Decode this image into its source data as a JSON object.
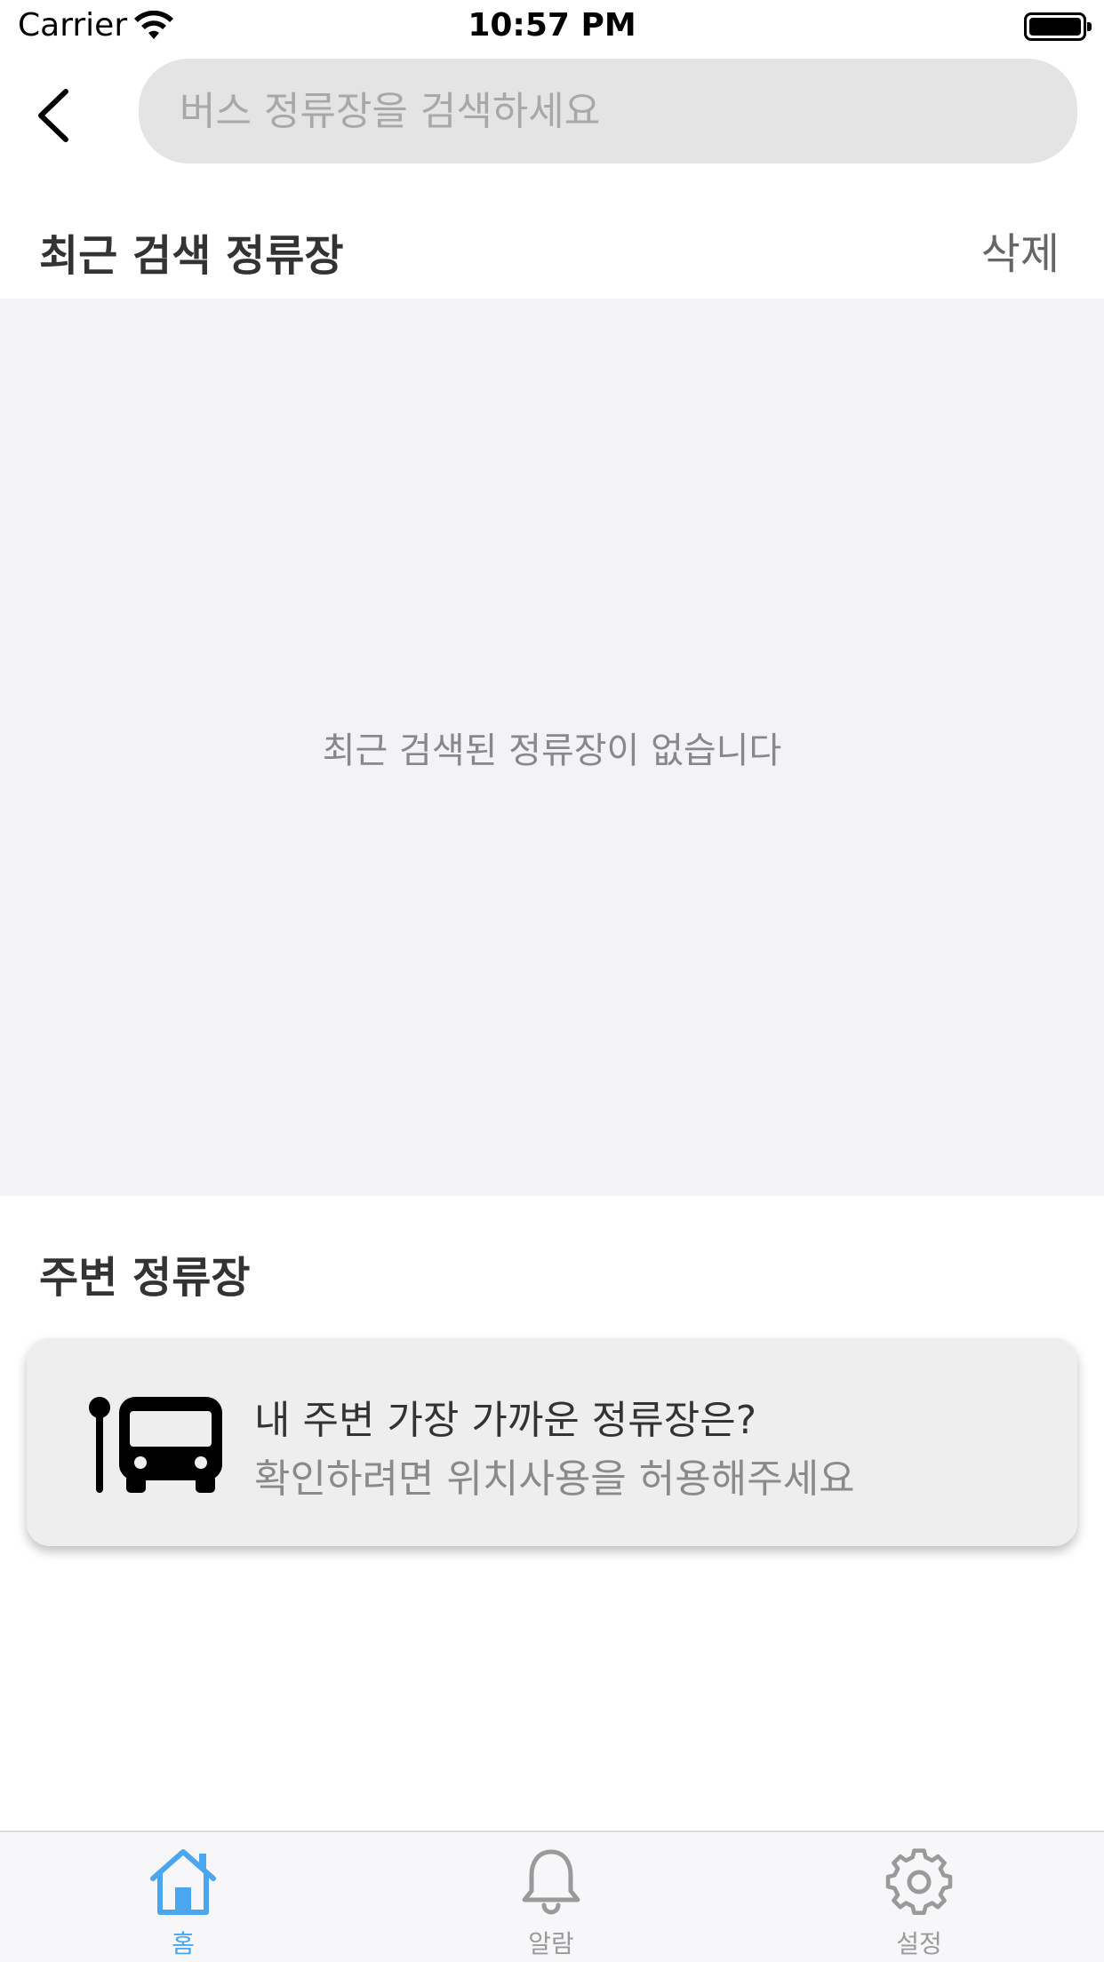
{
  "status_bar": {
    "carrier": "Carrier",
    "time": "10:57 PM"
  },
  "search": {
    "placeholder": "버스 정류장을 검색하세요",
    "value": ""
  },
  "recent": {
    "title": "최근 검색 정류장",
    "delete_label": "삭제",
    "empty_message": "최근 검색된 정류장이 없습니다"
  },
  "nearby": {
    "title": "주변 정류장",
    "card_title": "내 주변 가장 가까운 정류장은?",
    "card_subtitle": "확인하려면 위치사용을 허용해주세요",
    "card_icon": "bus-stop-icon"
  },
  "tab_bar": {
    "tabs": [
      {
        "label": "홈",
        "icon": "home-icon",
        "active": true
      },
      {
        "label": "알람",
        "icon": "bell-icon",
        "active": false
      },
      {
        "label": "설정",
        "icon": "gear-icon",
        "active": false
      }
    ]
  },
  "colors": {
    "accent": "#4aa6ee",
    "inactive": "#9a9a9a",
    "search_bg": "#e4e4e4",
    "recent_bg": "#f2f2f7",
    "card_bg": "#eeeeee"
  }
}
